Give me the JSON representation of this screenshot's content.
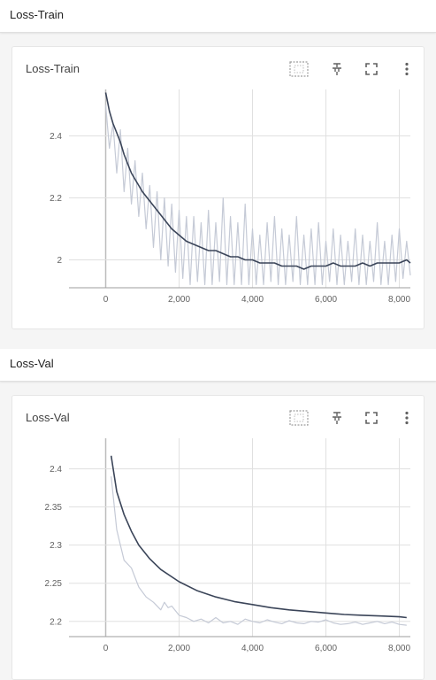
{
  "sections": [
    {
      "header": "Loss-Train",
      "card_title": "Loss-Train",
      "icons": [
        "fit-domain-icon",
        "pin-icon",
        "fullscreen-icon",
        "more-vert-icon"
      ]
    },
    {
      "header": "Loss-Val",
      "card_title": "Loss-Val",
      "icons": [
        "fit-domain-icon",
        "pin-icon",
        "fullscreen-icon",
        "more-vert-icon"
      ]
    }
  ],
  "colors": {
    "smoothed_line": "#3b4559",
    "raw_line": "#c5cad6",
    "grid": "#e0e0e0",
    "axis_text": "#616161"
  },
  "chart_data": [
    {
      "type": "line",
      "title": "Loss-Train",
      "xlim": [
        -1000,
        8300
      ],
      "ylim": [
        1.91,
        2.55
      ],
      "xticks": [
        0,
        2000,
        4000,
        6000,
        8000
      ],
      "xtick_labels": [
        "0",
        "2,000",
        "4,000",
        "6,000",
        "8,000"
      ],
      "yticks": [
        2,
        2.2,
        2.4
      ],
      "ytick_labels": [
        "2",
        "2.2",
        "2.4"
      ],
      "grid": true,
      "series": [
        {
          "role": "smoothed",
          "x": [
            0,
            100,
            200,
            300,
            400,
            500,
            600,
            700,
            800,
            900,
            1000,
            1200,
            1400,
            1600,
            1800,
            2000,
            2200,
            2400,
            2600,
            2800,
            3000,
            3200,
            3400,
            3600,
            3800,
            4000,
            4200,
            4400,
            4600,
            4800,
            5000,
            5200,
            5400,
            5600,
            5800,
            6000,
            6200,
            6400,
            6600,
            6800,
            7000,
            7200,
            7400,
            7600,
            7800,
            8000,
            8200,
            8300
          ],
          "y": [
            2.54,
            2.48,
            2.44,
            2.41,
            2.38,
            2.34,
            2.31,
            2.28,
            2.26,
            2.24,
            2.22,
            2.19,
            2.16,
            2.13,
            2.1,
            2.08,
            2.06,
            2.05,
            2.04,
            2.03,
            2.03,
            2.02,
            2.01,
            2.01,
            2.0,
            2.0,
            1.99,
            1.99,
            1.99,
            1.98,
            1.98,
            1.98,
            1.97,
            1.98,
            1.98,
            1.98,
            1.99,
            1.98,
            1.98,
            1.98,
            1.99,
            1.98,
            1.99,
            1.99,
            1.99,
            1.99,
            2.0,
            1.99
          ]
        },
        {
          "role": "raw",
          "x": [
            0,
            100,
            200,
            300,
            400,
            500,
            600,
            700,
            800,
            900,
            1000,
            1100,
            1200,
            1300,
            1400,
            1500,
            1600,
            1700,
            1800,
            1900,
            2000,
            2100,
            2200,
            2300,
            2400,
            2500,
            2600,
            2700,
            2800,
            2900,
            3000,
            3100,
            3200,
            3300,
            3400,
            3500,
            3600,
            3700,
            3800,
            3900,
            4000,
            4100,
            4200,
            4300,
            4400,
            4500,
            4600,
            4700,
            4800,
            4900,
            5000,
            5100,
            5200,
            5300,
            5400,
            5500,
            5600,
            5700,
            5800,
            5900,
            6000,
            6100,
            6200,
            6300,
            6400,
            6500,
            6600,
            6700,
            6800,
            6900,
            7000,
            7100,
            7200,
            7300,
            7400,
            7500,
            7600,
            7700,
            7800,
            7900,
            8000,
            8100,
            8200,
            8300
          ],
          "y": [
            2.5,
            2.36,
            2.44,
            2.28,
            2.42,
            2.22,
            2.36,
            2.18,
            2.32,
            2.14,
            2.28,
            2.1,
            2.24,
            2.04,
            2.22,
            2.0,
            2.2,
            1.98,
            2.18,
            1.96,
            2.16,
            1.94,
            2.14,
            1.92,
            2.14,
            1.93,
            2.12,
            1.92,
            2.16,
            1.92,
            2.12,
            1.93,
            2.2,
            1.92,
            2.14,
            1.92,
            2.12,
            1.92,
            2.18,
            1.92,
            2.1,
            1.92,
            2.08,
            1.92,
            2.12,
            1.93,
            2.14,
            1.92,
            2.1,
            1.92,
            2.08,
            1.93,
            2.14,
            1.92,
            2.08,
            1.92,
            2.1,
            1.92,
            2.12,
            1.92,
            2.06,
            1.93,
            2.1,
            1.92,
            2.08,
            1.92,
            2.06,
            1.93,
            2.1,
            1.92,
            2.08,
            1.92,
            2.06,
            1.93,
            2.12,
            1.92,
            2.06,
            1.92,
            2.08,
            1.93,
            2.1,
            1.94,
            2.06,
            1.95
          ]
        }
      ]
    },
    {
      "type": "line",
      "title": "Loss-Val",
      "xlim": [
        -1000,
        8300
      ],
      "ylim": [
        2.18,
        2.44
      ],
      "xticks": [
        0,
        2000,
        4000,
        6000,
        8000
      ],
      "xtick_labels": [
        "0",
        "2,000",
        "4,000",
        "6,000",
        "8,000"
      ],
      "yticks": [
        2.2,
        2.25,
        2.3,
        2.35,
        2.4
      ],
      "ytick_labels": [
        "2.2",
        "2.25",
        "2.3",
        "2.35",
        "2.4"
      ],
      "grid": true,
      "series": [
        {
          "role": "smoothed",
          "x": [
            150,
            300,
            500,
            700,
            900,
            1200,
            1500,
            2000,
            2500,
            3000,
            3500,
            4000,
            4500,
            5000,
            5500,
            6000,
            6500,
            7000,
            7500,
            8000,
            8200
          ],
          "y": [
            2.417,
            2.37,
            2.34,
            2.318,
            2.3,
            2.282,
            2.268,
            2.252,
            2.24,
            2.232,
            2.226,
            2.222,
            2.218,
            2.215,
            2.213,
            2.211,
            2.209,
            2.208,
            2.207,
            2.206,
            2.205
          ]
        },
        {
          "role": "raw",
          "x": [
            150,
            300,
            500,
            700,
            900,
            1100,
            1300,
            1500,
            1600,
            1700,
            1800,
            2000,
            2200,
            2400,
            2600,
            2800,
            3000,
            3200,
            3400,
            3600,
            3800,
            4000,
            4200,
            4400,
            4600,
            4800,
            5000,
            5200,
            5400,
            5600,
            5800,
            6000,
            6200,
            6400,
            6600,
            6800,
            7000,
            7200,
            7400,
            7600,
            7800,
            8000,
            8200
          ],
          "y": [
            2.39,
            2.32,
            2.28,
            2.27,
            2.245,
            2.232,
            2.225,
            2.215,
            2.225,
            2.218,
            2.22,
            2.208,
            2.205,
            2.2,
            2.203,
            2.198,
            2.205,
            2.198,
            2.2,
            2.196,
            2.203,
            2.2,
            2.198,
            2.202,
            2.199,
            2.197,
            2.201,
            2.198,
            2.197,
            2.2,
            2.199,
            2.202,
            2.198,
            2.196,
            2.197,
            2.199,
            2.196,
            2.198,
            2.2,
            2.197,
            2.199,
            2.196,
            2.195
          ]
        }
      ]
    }
  ]
}
